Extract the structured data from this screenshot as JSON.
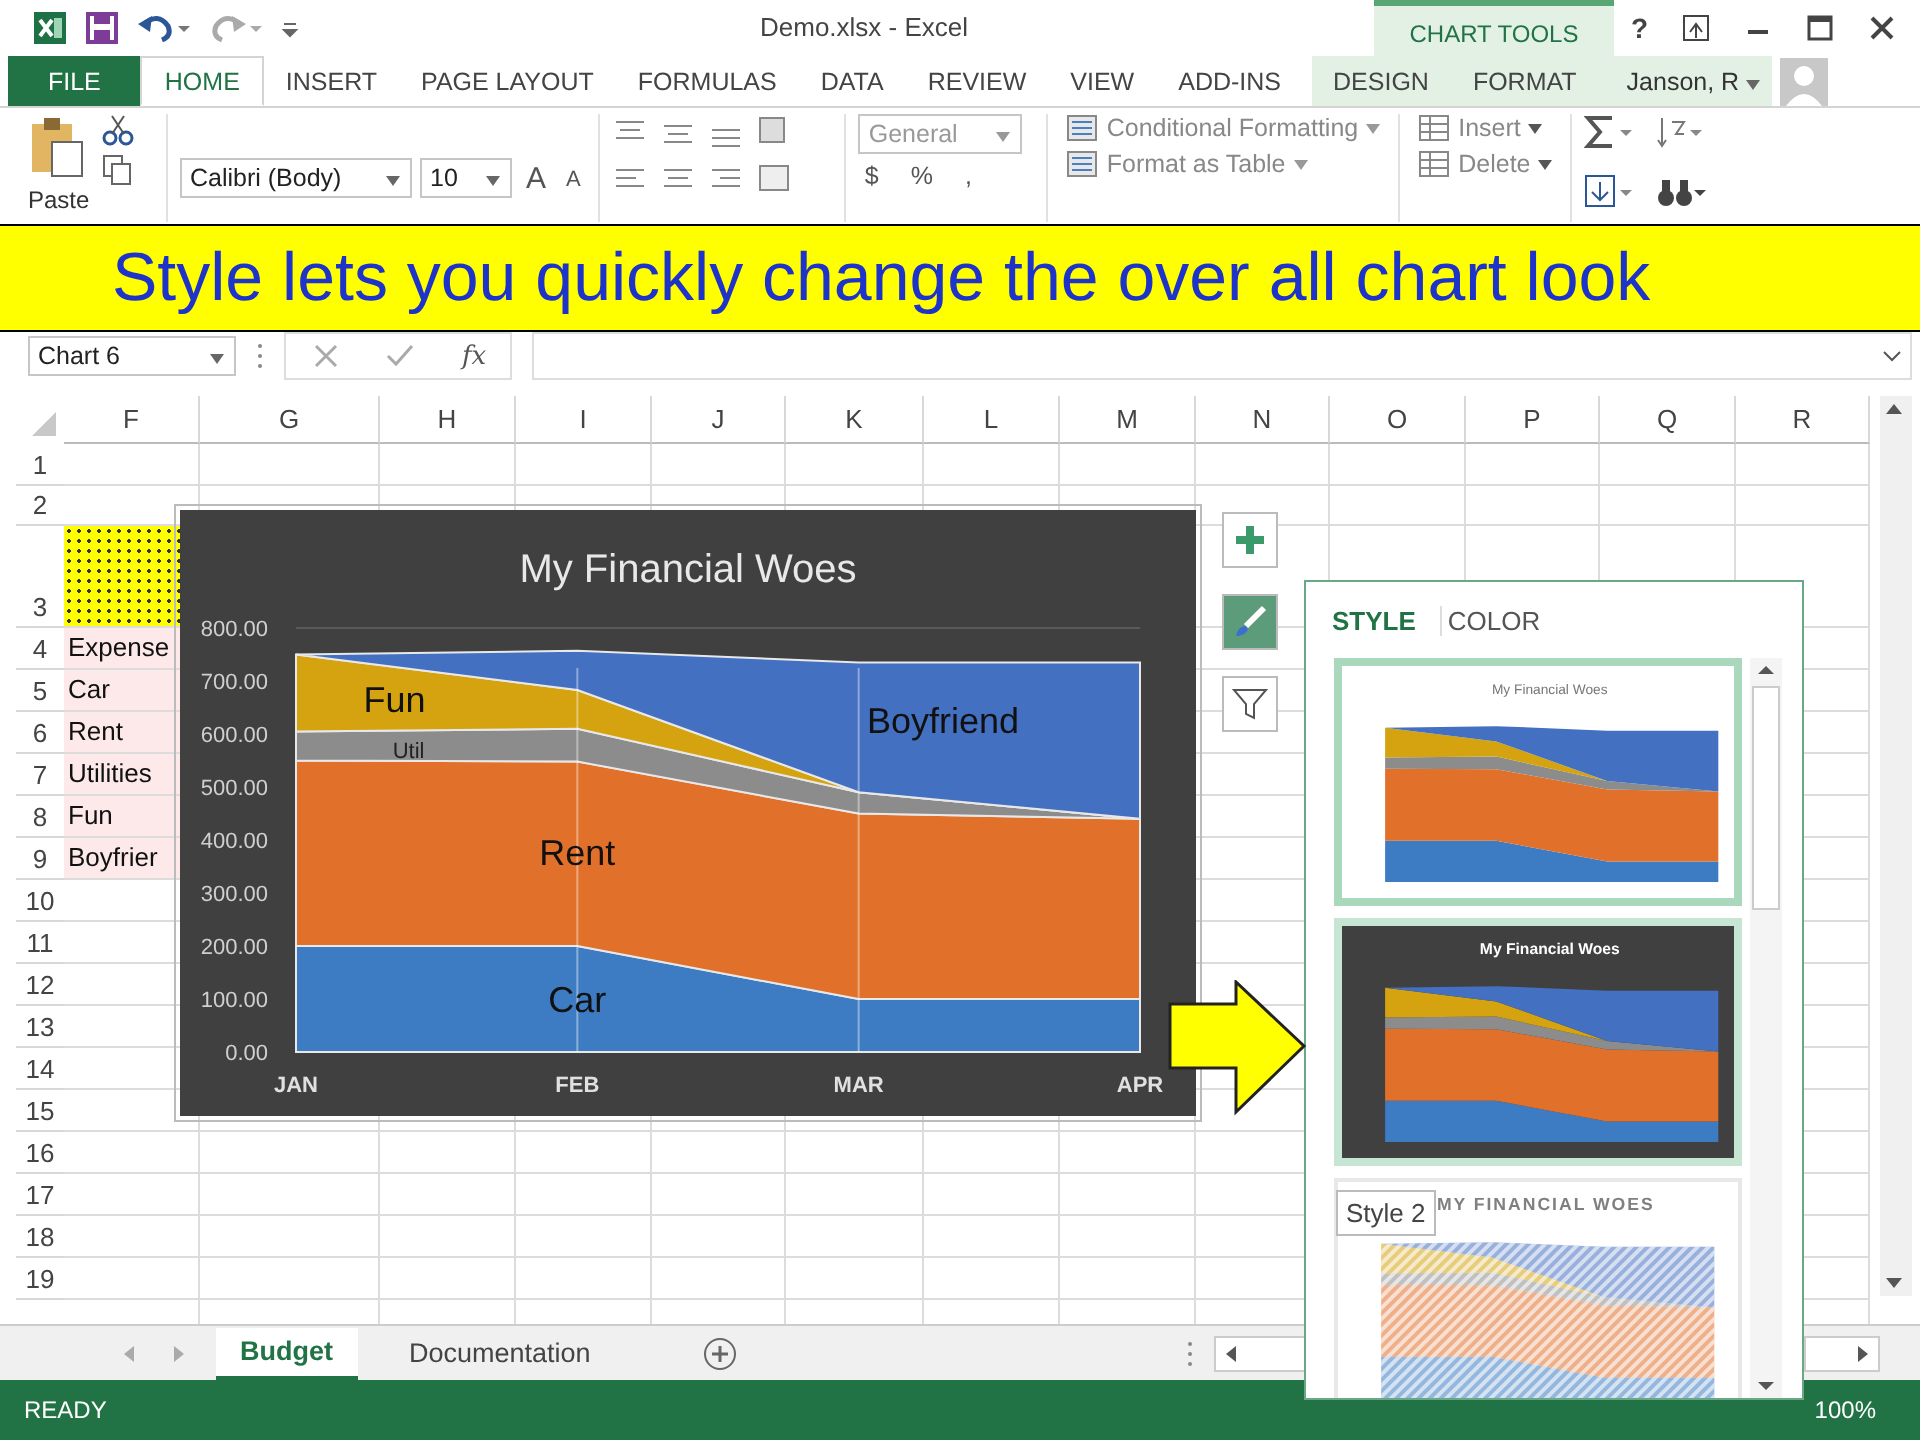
{
  "title_bar": {
    "title": "Demo.xlsx - Excel",
    "context_group": "CHART TOOLS",
    "help": "?"
  },
  "tabs": [
    {
      "label": "FILE",
      "kind": "file",
      "selected": false
    },
    {
      "label": "HOME",
      "kind": "tab",
      "selected": true
    },
    {
      "label": "INSERT",
      "kind": "tab",
      "selected": false
    },
    {
      "label": "PAGE LAYOUT",
      "kind": "tab",
      "selected": false
    },
    {
      "label": "FORMULAS",
      "kind": "tab",
      "selected": false
    },
    {
      "label": "DATA",
      "kind": "tab",
      "selected": false
    },
    {
      "label": "REVIEW",
      "kind": "tab",
      "selected": false
    },
    {
      "label": "VIEW",
      "kind": "tab",
      "selected": false
    },
    {
      "label": "ADD-INS",
      "kind": "tab",
      "selected": false
    },
    {
      "label": "DESIGN",
      "kind": "context",
      "selected": false
    },
    {
      "label": "FORMAT",
      "kind": "context",
      "selected": false
    }
  ],
  "account": {
    "name": "Janson, R"
  },
  "ribbon": {
    "paste": "Paste",
    "font": "Calibri (Body)",
    "size": "10",
    "grow": "A",
    "shrink": "A",
    "number_format": "General",
    "currency": "$",
    "percent": "%",
    "comma": ",",
    "styles": [
      "Conditional Formatting",
      "Format as Table"
    ],
    "cells": [
      "Insert",
      "Delete"
    ]
  },
  "banner": "Style lets you quickly change the over all chart look",
  "formula_bar": {
    "name_box": "Chart 6",
    "fx": "fx"
  },
  "sheet": {
    "columns": [
      "F",
      "G",
      "H",
      "I",
      "J",
      "K",
      "L",
      "M",
      "N",
      "O",
      "P",
      "Q",
      "R"
    ],
    "rows": [
      "1",
      "2",
      "3",
      "4",
      "5",
      "6",
      "7",
      "8",
      "9",
      "10",
      "11",
      "12",
      "13",
      "14",
      "15",
      "16",
      "17",
      "18",
      "19"
    ],
    "column_f": [
      "Expense",
      "Car",
      "Rent",
      "Utilities",
      "Fun",
      "Boyfrier"
    ]
  },
  "chart": {
    "chart_data": {
      "type": "area",
      "stacked": true,
      "title": "My Financial Woes",
      "categories": [
        "JAN",
        "FEB",
        "MAR",
        "APR"
      ],
      "series": [
        {
          "name": "Car",
          "color": "#3d7cc2",
          "values": [
            200,
            200,
            100,
            100
          ]
        },
        {
          "name": "Rent",
          "color": "#e0702a",
          "values": [
            350,
            348,
            350,
            340
          ]
        },
        {
          "name": "Util",
          "color": "#8c8c8c",
          "values": [
            55,
            62,
            40,
            0
          ]
        },
        {
          "name": "Fun",
          "color": "#d4a30f",
          "values": [
            145,
            73,
            0,
            0
          ]
        },
        {
          "name": "Boyfriend",
          "color": "#4370c0",
          "values": [
            0,
            74,
            245,
            295
          ]
        }
      ],
      "ylim": [
        0,
        800
      ],
      "yticks": [
        {
          "value": 0,
          "label": "0.00"
        },
        {
          "value": 100,
          "label": "100.00"
        },
        {
          "value": 200,
          "label": "200.00"
        },
        {
          "value": 300,
          "label": "300.00"
        },
        {
          "value": 400,
          "label": "400.00"
        },
        {
          "value": 500,
          "label": "500.00"
        },
        {
          "value": 600,
          "label": "600.00"
        },
        {
          "value": 700,
          "label": "700.00"
        },
        {
          "value": 800,
          "label": "800.00"
        }
      ]
    }
  },
  "chart_buttons": [
    {
      "kind": "add",
      "selected": false
    },
    {
      "kind": "style",
      "selected": true
    },
    {
      "kind": "filter",
      "selected": false
    }
  ],
  "style_panel": {
    "tabs": [
      {
        "label": "STYLE",
        "selected": true
      },
      {
        "label": "COLOR",
        "selected": false
      }
    ],
    "styles": [
      {
        "kind": "light",
        "title": "My Financial Woes",
        "hovered": true,
        "selected": false
      },
      {
        "kind": "dark",
        "title": "My Financial Woes",
        "hovered": false,
        "selected": true
      },
      {
        "kind": "hatched",
        "title": "MY FINANCIAL WOES",
        "hovered": false,
        "selected": false
      }
    ],
    "tooltip": "Style 2"
  },
  "sheet_tabs": [
    {
      "label": "Budget",
      "selected": true
    },
    {
      "label": "Documentation",
      "selected": false
    }
  ],
  "status_bar": {
    "status": "READY",
    "zoom": "100%"
  }
}
